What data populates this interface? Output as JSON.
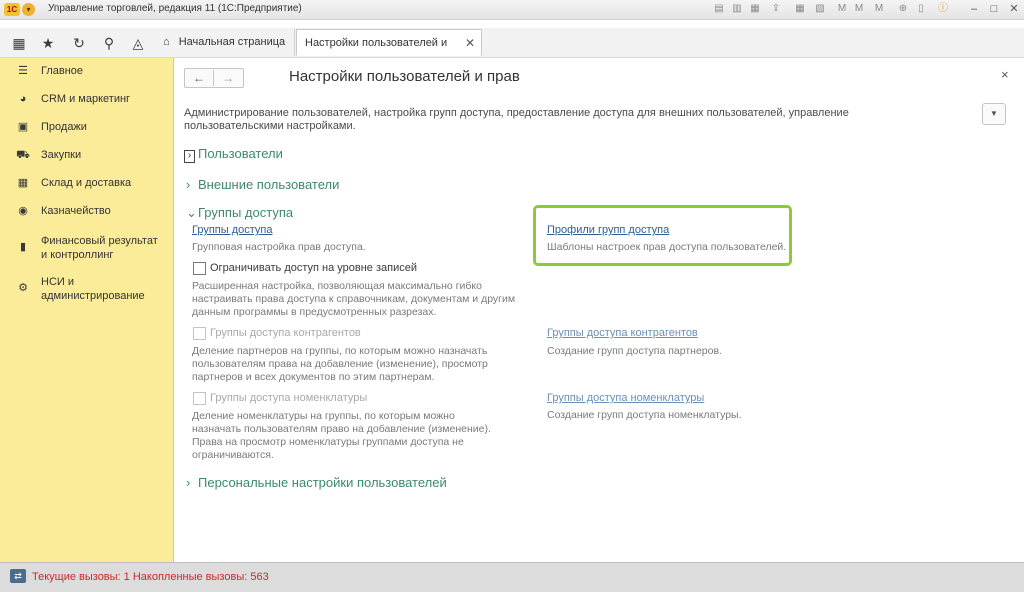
{
  "window": {
    "logo_text": "1С",
    "title": "Управление торговлей, редакция 11  (1С:Предприятие)"
  },
  "colors": {
    "sidebar_bg": "#fbec99",
    "group_header": "#3c8a6e",
    "link": "#2d5e99",
    "highlight_border": "#8fc93a",
    "status_text": "#c82a2a"
  },
  "tabs": {
    "home": "Начальная страница",
    "active": "Настройки пользователей и прав",
    "close_glyph": "✕"
  },
  "sidebar": {
    "items": [
      {
        "label": "Главное",
        "icon": "menu-lines-icon"
      },
      {
        "label": "CRM и маркетинг",
        "icon": "pie-chart-icon"
      },
      {
        "label": "Продажи",
        "icon": "bag-icon"
      },
      {
        "label": "Закупки",
        "icon": "cart-icon"
      },
      {
        "label": "Склад и доставка",
        "icon": "grid-icon"
      },
      {
        "label": "Казначейство",
        "icon": "coin-icon"
      },
      {
        "label": "Финансовый результат и контроллинг",
        "icon": "bar-chart-icon"
      },
      {
        "label": "НСИ и администрирование",
        "icon": "gear-icon"
      }
    ]
  },
  "form": {
    "back": "←",
    "forward": "→",
    "title": "Настройки пользователей и прав",
    "close": "×",
    "description": "Администрирование пользователей, настройка групп доступа, предоставление доступа для внешних пользователей, управление пользовательскими настройками.",
    "more_button": "▼"
  },
  "groups": {
    "users": "Пользователи",
    "external_users": "Внешние пользователи",
    "access_groups": "Группы доступа",
    "personal_settings": "Персональные настройки пользователей"
  },
  "access": {
    "groups_link": "Группы доступа",
    "groups_note": "Групповая настройка прав доступа.",
    "restrict_label": "Ограничивать доступ на уровне записей",
    "restrict_note_1": "Расширенная настройка, позволяющая максимально гибко",
    "restrict_note_2": "настраивать права доступа к справочникам, документам и другим",
    "restrict_note_3": "данным программы в предусмотренных разрезах.",
    "contractor_groups_label": "Группы доступа контрагентов",
    "contractor_note_1": "Деление партнеров на группы, по которым можно назначать",
    "contractor_note_2": "пользователям права на добавление (изменение), просмотр",
    "contractor_note_3": "партнеров и всех документов по этим партнерам.",
    "nomenclature_groups_label": "Группы доступа номенклатуры",
    "nomenclature_note_1": "Деление номенклатуры на группы, по которым можно",
    "nomenclature_note_2": "назначать пользователям право на добавление (изменение).",
    "nomenclature_note_3": "Права на просмотр номенклатуры группами доступа не",
    "nomenclature_note_4": "ограничиваются.",
    "profiles_link": "Профили групп доступа",
    "profiles_note": "Шаблоны настроек прав доступа пользователей.",
    "contractor_groups_link": "Группы доступа контрагентов",
    "contractor_groups_link_note": "Создание групп доступа партнеров.",
    "nomenclature_groups_link": "Группы доступа номенклатуры",
    "nomenclature_groups_link_note": "Создание групп доступа номенклатуры."
  },
  "status": {
    "text": "Текущие вызовы: 1    Накопленные вызовы: 563"
  }
}
